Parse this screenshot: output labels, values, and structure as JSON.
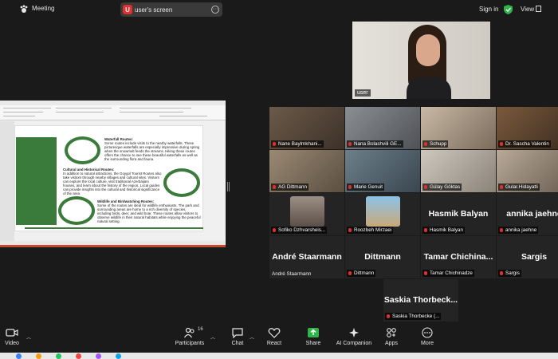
{
  "topbar": {
    "meeting_label": "Meeting",
    "share_badge": "U",
    "share_text": "user's screen",
    "signin": "Sign in",
    "view": "View"
  },
  "self_view": {
    "name": "user"
  },
  "shared_slide": {
    "block1_title": "Waterfall Routes:",
    "block1_body": "Some routes include visits to the nearby waterfalls. These picturesque waterfalls are especially impressive during spring when the snowmelt feeds the streams. Hiking these routes offers the chance to see these beautiful waterfalls as well as the surrounding flora and fauna.",
    "block2_title": "Cultural and Historical Routes:",
    "block2_body": "In addition to natural attractions, the Goygol Tourist Routes also take visitors through nearby villages and cultural sites. Visitors can explore the local culture, visit traditional Azerbaijani houses, and learn about the history of the region. Local guides can provide insights into the cultural and historical significance of the area.",
    "block3_title": "Wildlife and Birdwatching Routes:",
    "block3_body": "Some of the routes are ideal for wildlife enthusiasts. The park and surrounding areas are home to a rich diversity of species, including birds, deer, and wild boar. These routes allow visitors to observe wildlife in their natural habitats while enjoying the peaceful natural setting."
  },
  "participants_tiles": [
    {
      "label": "Nane Baylmkhani...",
      "type": "video"
    },
    {
      "label": "Nana Bolashvili GE...",
      "type": "video"
    },
    {
      "label": "Schupp",
      "type": "video"
    },
    {
      "label": "Dr. Sascha Valentin",
      "type": "video"
    },
    {
      "label": "AG Dittmann",
      "type": "video"
    },
    {
      "label": "Marie Genuit",
      "type": "video"
    },
    {
      "label": "Gülay Göktas",
      "type": "video"
    },
    {
      "label": "Gular.Hidayatli",
      "type": "video"
    },
    {
      "label": "Sofiko Dzhvarsheis...",
      "type": "photo"
    },
    {
      "label": "Roozbeh Mirzaei",
      "type": "photo"
    },
    {
      "label": "Hasmik Balyan",
      "big": "Hasmik Balyan",
      "type": "name"
    },
    {
      "label": "annika jaehne",
      "big": "annika jaehne",
      "type": "name"
    },
    {
      "label": "André Staarmann",
      "big": "André Staarmann",
      "type": "name",
      "nomic": true
    },
    {
      "label": "Dittmann",
      "big": "Dittmann",
      "type": "name"
    },
    {
      "label": "Tamar Chichinadze",
      "big": "Tamar  Chichina...",
      "type": "name"
    },
    {
      "label": "Sargis",
      "big": "Sargis",
      "type": "name"
    },
    {
      "label": "Saskia Thorbecke (...",
      "big": "Saskia  Thorbeck...",
      "type": "name"
    }
  ],
  "toolbar": {
    "video": "Video",
    "participants": "Participants",
    "participants_count": "16",
    "chat": "Chat",
    "react": "React",
    "share": "Share",
    "ai_companion": "AI Companion",
    "apps": "Apps",
    "more": "More"
  },
  "colors": {
    "accent_green": "#2fb34a",
    "mute_red": "#e02f2f",
    "slide_green": "#3a7a3a"
  }
}
